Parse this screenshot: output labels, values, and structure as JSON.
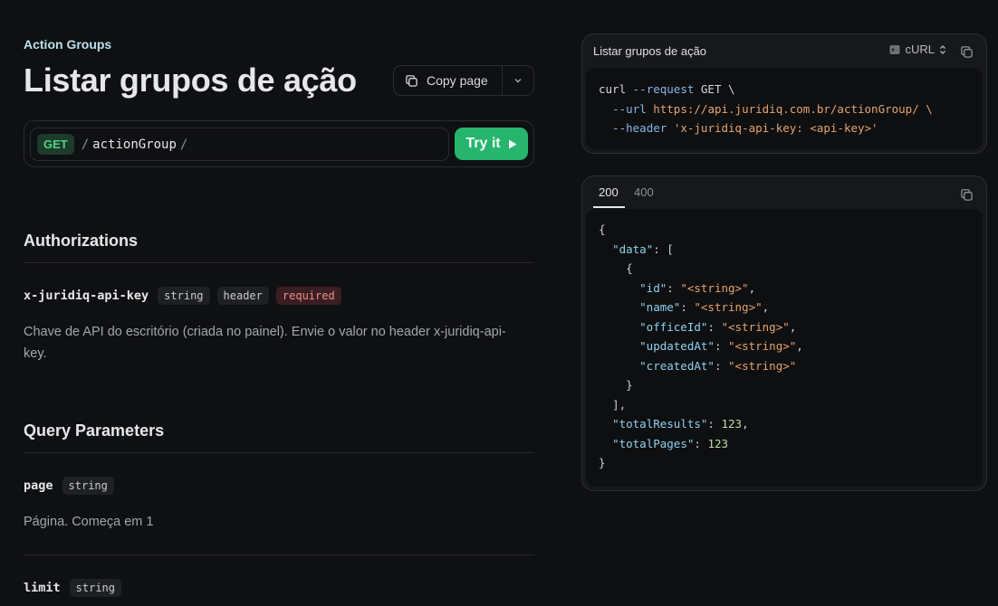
{
  "breadcrumb": "Action Groups",
  "title": "Listar grupos de ação",
  "copy_page": {
    "label": "Copy page"
  },
  "endpoint": {
    "method": "GET",
    "path_prefix": "/",
    "path": "actionGroup",
    "path_suffix": "/",
    "try_label": "Try it"
  },
  "authorizations": {
    "title": "Authorizations",
    "param": {
      "name": "x-juridiq-api-key",
      "type": "string",
      "location": "header",
      "required": "required",
      "desc_line1": "Chave de API do escritório (criada no painel). Envie o valor no header x-juridiq-api-",
      "desc_line2": "key."
    }
  },
  "query": {
    "title": "Query Parameters",
    "params": [
      {
        "name": "page",
        "type": "string",
        "description": "Página. Começa em 1"
      },
      {
        "name": "limit",
        "type": "string",
        "description": ""
      }
    ]
  },
  "request_panel": {
    "title": "Listar grupos de ação",
    "language": "cURL",
    "code": {
      "line1_cmd": "curl",
      "line1_flag": "--request",
      "line1_val": "GET \\",
      "line2_flag": "--url",
      "line2_val": "https://api.juridiq.com.br/actionGroup/ \\",
      "line3_flag": "--header",
      "line3_val": "'x-juridiq-api-key: <api-key>'"
    }
  },
  "response_panel": {
    "tabs": [
      "200",
      "400"
    ],
    "fields": {
      "data": "\"data\"",
      "id": "\"id\"",
      "name": "\"name\"",
      "officeId": "\"officeId\"",
      "updatedAt": "\"updatedAt\"",
      "createdAt": "\"createdAt\"",
      "totalResults": "\"totalResults\"",
      "totalPages": "\"totalPages\""
    },
    "string_placeholder": "\"<string>\"",
    "total_results": "123",
    "total_pages": "123"
  },
  "colors": {
    "accent_green": "#27b56e",
    "method_green": "#4ed384",
    "required_red": "#f28b8b"
  }
}
